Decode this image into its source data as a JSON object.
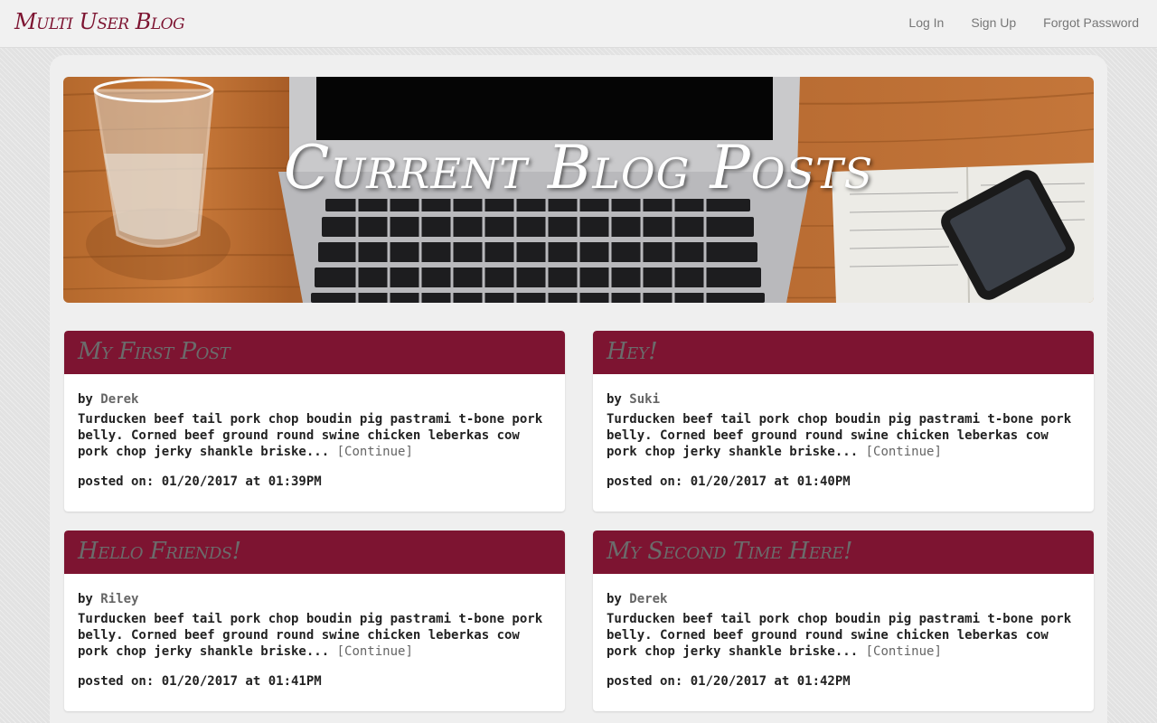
{
  "nav": {
    "brand": "Multi User Blog",
    "links": [
      "Log In",
      "Sign Up",
      "Forgot Password"
    ]
  },
  "hero": {
    "title": "Current Blog Posts"
  },
  "posts": [
    {
      "title": "My First Post",
      "by_label": "by",
      "author": "Derek",
      "excerpt": "Turducken beef tail pork chop boudin pig pastrami t-bone pork belly. Corned beef ground round swine chicken leberkas cow pork chop jerky shankle briske...",
      "continue_label": "[Continue]",
      "posted_on": "posted on: 01/20/2017 at 01:39PM"
    },
    {
      "title": "Hey!",
      "by_label": "by",
      "author": "Suki",
      "excerpt": "Turducken beef tail pork chop boudin pig pastrami t-bone pork belly. Corned beef ground round swine chicken leberkas cow pork chop jerky shankle briske...",
      "continue_label": "[Continue]",
      "posted_on": "posted on: 01/20/2017 at 01:40PM"
    },
    {
      "title": "Hello Friends!",
      "by_label": "by",
      "author": "Riley",
      "excerpt": "Turducken beef tail pork chop boudin pig pastrami t-bone pork belly. Corned beef ground round swine chicken leberkas cow pork chop jerky shankle briske...",
      "continue_label": "[Continue]",
      "posted_on": "posted on: 01/20/2017 at 01:41PM"
    },
    {
      "title": "My Second Time Here!",
      "by_label": "by",
      "author": "Derek",
      "excerpt": "Turducken beef tail pork chop boudin pig pastrami t-bone pork belly. Corned beef ground round swine chicken leberkas cow pork chop jerky shankle briske...",
      "continue_label": "[Continue]",
      "posted_on": "posted on: 01/20/2017 at 01:42PM"
    }
  ],
  "colors": {
    "accent": "#7d1431",
    "card_title": "#6b6b6b",
    "nav_link": "#777777"
  }
}
